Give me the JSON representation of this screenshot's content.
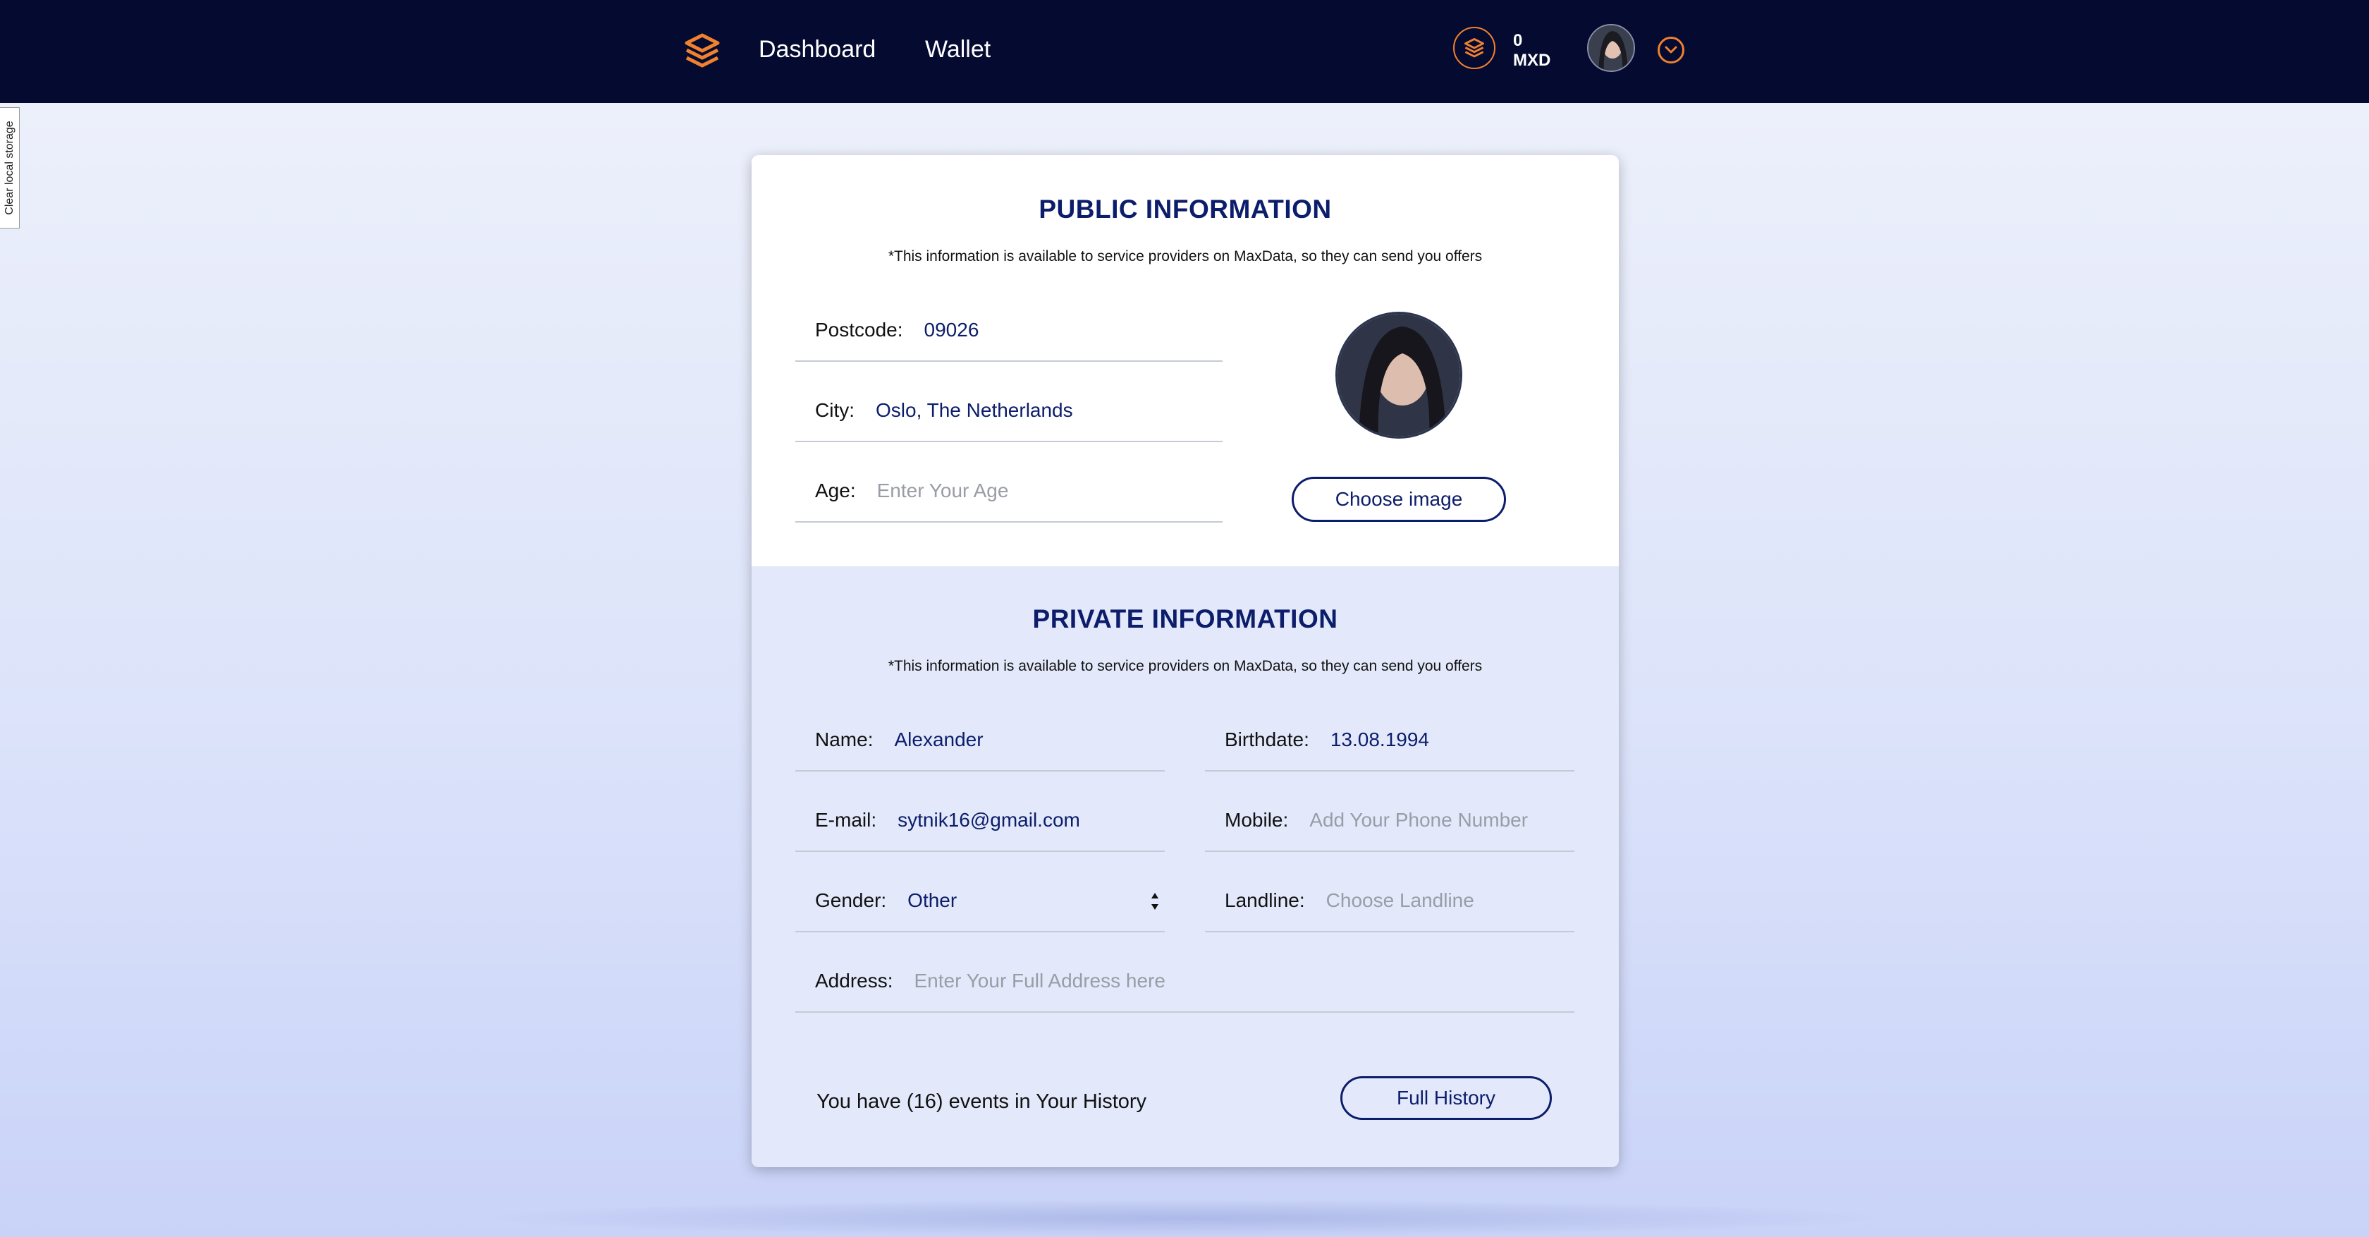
{
  "nav": {
    "links": [
      "Dashboard",
      "Wallet"
    ],
    "balance_amount": "0",
    "balance_currency": "MXD"
  },
  "dev": {
    "clear_storage": "Clear local storage"
  },
  "public": {
    "title": "PUBLIC INFORMATION",
    "note": "*This information is available to service providers on MaxData, so they can send you offers",
    "postcode": {
      "label": "Postcode:",
      "value": "09026"
    },
    "city": {
      "label": "City:",
      "value": "Oslo, The Netherlands"
    },
    "age": {
      "label": "Age:",
      "placeholder": "Enter Your Age"
    },
    "choose_image": "Choose image"
  },
  "private": {
    "title": "PRIVATE INFORMATION",
    "note": "*This information is available to service providers on MaxData, so they can send you offers",
    "name": {
      "label": "Name:",
      "value": "Alexander"
    },
    "birthdate": {
      "label": "Birthdate:",
      "value": "13.08.1994"
    },
    "email": {
      "label": "E-mail:",
      "value": "sytnik16@gmail.com"
    },
    "mobile": {
      "label": "Mobile:",
      "placeholder": "Add Your Phone Number"
    },
    "gender": {
      "label": "Gender:",
      "value": "Other"
    },
    "landline": {
      "label": "Landline:",
      "placeholder": "Choose Landline"
    },
    "address": {
      "label": "Address:",
      "placeholder": "Enter Your Full Address here"
    },
    "history_text": "You have (16) events in Your History",
    "full_history": "Full History"
  },
  "colors": {
    "nav_bg": "#050a31",
    "accent": "#f0812f",
    "primary": "#0c1d6b"
  }
}
